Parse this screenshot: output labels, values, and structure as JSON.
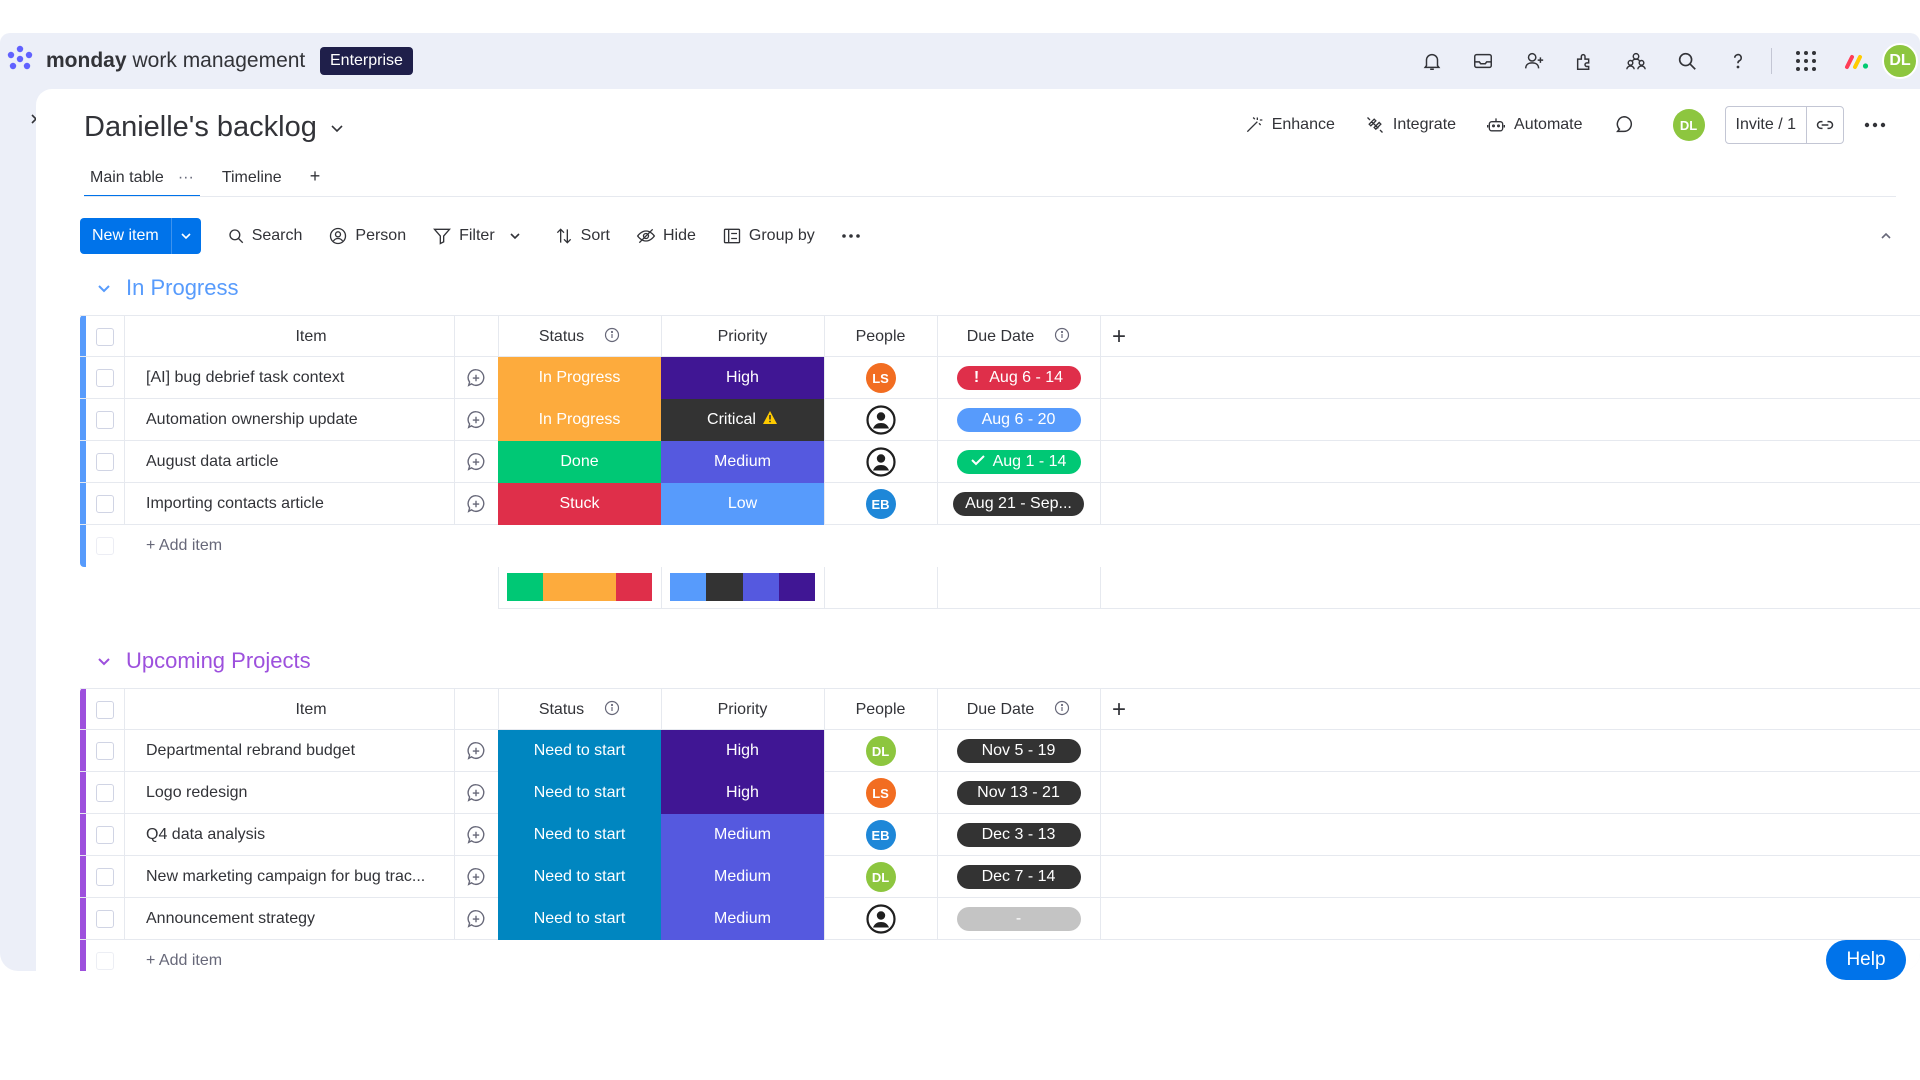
{
  "app": {
    "brand_bold": "monday",
    "brand_rest": "work management",
    "badge": "Enterprise",
    "user_initials": "DL"
  },
  "board": {
    "title": "Danielle's backlog",
    "actions": {
      "enhance": "Enhance",
      "integrate": "Integrate",
      "automate": "Automate",
      "invite": "Invite / 1",
      "avatar": "DL"
    },
    "tabs": [
      {
        "label": "Main table",
        "active": true
      },
      {
        "label": "Timeline",
        "active": false
      }
    ],
    "tab_add": "+"
  },
  "toolbar": {
    "new_item": "New item",
    "search": "Search",
    "person": "Person",
    "filter": "Filter",
    "sort": "Sort",
    "hide": "Hide",
    "group_by": "Group by"
  },
  "columns": {
    "item": "Item",
    "status": "Status",
    "priority": "Priority",
    "people": "People",
    "due_date": "Due Date",
    "add": "+"
  },
  "colors": {
    "working_on_it": "#fdab3d",
    "done": "#00c875",
    "stuck": "#df2f4a",
    "need_to_start": "#0086c0",
    "high": "#401694",
    "critical": "#333333",
    "medium": "#5559df",
    "low": "#579bfc",
    "group_in_progress": "#579bfc",
    "group_upcoming": "#9d50dd",
    "avatar_ls": "#f26d21",
    "avatar_eb": "#1e87d8",
    "avatar_dl": "#8dc63f",
    "date_red": "#df2f4a",
    "date_blue": "#579bfc",
    "date_green": "#00c875",
    "date_dark": "#333333",
    "date_empty": "#c4c4c4"
  },
  "groups": [
    {
      "title": "In Progress",
      "add_item": "+ Add item",
      "rows": [
        {
          "item": "[AI] bug debrief task context",
          "status": "In Progress",
          "priority": "High",
          "people": "LS",
          "due": "Aug 6 - 14",
          "due_icon": "exclamation-icon"
        },
        {
          "item": "Automation ownership update",
          "status": "In Progress",
          "priority": "Critical",
          "priority_icon": "warning-icon",
          "people": "",
          "due": "Aug 6 - 20"
        },
        {
          "item": "August data article",
          "status": "Done",
          "priority": "Medium",
          "people": "",
          "due": "Aug 1 - 14",
          "due_icon": "check-icon"
        },
        {
          "item": "Importing contacts article",
          "status": "Stuck",
          "priority": "Low",
          "people": "EB",
          "due": "Aug 21 - Sep..."
        }
      ],
      "summary_status": [
        0.25,
        0.5,
        0.25
      ],
      "summary_priority": [
        0.25,
        0.25,
        0.25,
        0.25
      ]
    },
    {
      "title": "Upcoming Projects",
      "add_item": "+ Add item",
      "rows": [
        {
          "item": "Departmental rebrand budget",
          "status": "Need to start",
          "priority": "High",
          "people": "DL",
          "due": "Nov 5 - 19"
        },
        {
          "item": "Logo redesign",
          "status": "Need to start",
          "priority": "High",
          "people": "LS",
          "due": "Nov 13 - 21"
        },
        {
          "item": "Q4 data analysis",
          "status": "Need to start",
          "priority": "Medium",
          "people": "EB",
          "due": "Dec 3 - 13"
        },
        {
          "item": "New marketing campaign for bug trac...",
          "status": "Need to start",
          "priority": "Medium",
          "people": "DL",
          "due": "Dec 7 - 14"
        },
        {
          "item": "Announcement strategy",
          "status": "Need to start",
          "priority": "Medium",
          "people": "",
          "due": "-"
        }
      ]
    }
  ],
  "help": "Help"
}
